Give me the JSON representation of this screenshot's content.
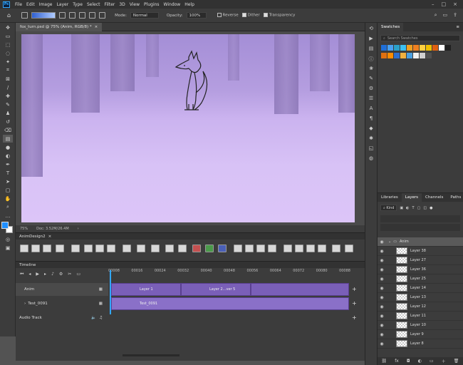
{
  "menu": [
    "File",
    "Edit",
    "Image",
    "Layer",
    "Type",
    "Select",
    "Filter",
    "3D",
    "View",
    "Plugins",
    "Window",
    "Help"
  ],
  "options": {
    "mode_label": "Mode:",
    "mode_value": "Normal",
    "opacity_label": "Opacity:",
    "opacity_value": "100%",
    "reverse": "Reverse",
    "dither": "Dither",
    "transparency": "Transparency"
  },
  "document": {
    "tab_title": "fox_turn.psd @ 75% (Anim, RGB/8) *",
    "zoom": "75%",
    "doc_info": "Doc: 3.52M/26.4M"
  },
  "actions_panel": {
    "title": "AnimDesign2"
  },
  "timeline": {
    "title": "Timeline",
    "ruler": [
      "00008",
      "00016",
      "00024",
      "00032",
      "00040",
      "00048",
      "00056",
      "00064",
      "00072",
      "00080",
      "00088"
    ],
    "tracks": [
      {
        "name": "Anim"
      },
      {
        "name": "Test_0091"
      },
      {
        "name": "Audio Track"
      }
    ],
    "clips": [
      "Layer 1",
      "Layer 2...ver 5",
      "Test_0091"
    ]
  },
  "swatches": {
    "tab": "Swatches",
    "search_placeholder": "Search Swatches",
    "colors": [
      "#1f6fd8",
      "#4aa0f0",
      "#2aa0c8",
      "#3cc0f0",
      "#f0a020",
      "#f08020",
      "#ffd040",
      "#f0c000",
      "#e06010",
      "#ffffff",
      "#202020",
      "#2f6fcf",
      "#e07010",
      "#ff8c00",
      "#f0b040",
      "#4a9fe0",
      "#f0f0f0",
      "#d0d0d0",
      "#505050"
    ]
  },
  "layers_panel": {
    "tabs": [
      "Libraries",
      "Layers",
      "Channels",
      "Paths"
    ],
    "kind": "Kind",
    "group": "Anim",
    "layers": [
      "Layer 38",
      "Layer 27",
      "Layer 36",
      "Layer 25",
      "Layer 14",
      "Layer 13",
      "Layer 12",
      "Layer 11",
      "Layer 10",
      "Layer 9",
      "Layer 8"
    ]
  }
}
